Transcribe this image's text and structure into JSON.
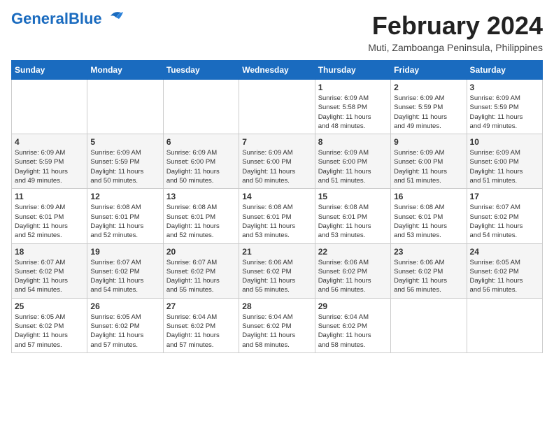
{
  "header": {
    "logo_general": "General",
    "logo_blue": "Blue",
    "title": "February 2024",
    "location": "Muti, Zamboanga Peninsula, Philippines"
  },
  "days_of_week": [
    "Sunday",
    "Monday",
    "Tuesday",
    "Wednesday",
    "Thursday",
    "Friday",
    "Saturday"
  ],
  "weeks": [
    [
      {
        "day": "",
        "info": ""
      },
      {
        "day": "",
        "info": ""
      },
      {
        "day": "",
        "info": ""
      },
      {
        "day": "",
        "info": ""
      },
      {
        "day": "1",
        "info": "Sunrise: 6:09 AM\nSunset: 5:58 PM\nDaylight: 11 hours\nand 48 minutes."
      },
      {
        "day": "2",
        "info": "Sunrise: 6:09 AM\nSunset: 5:59 PM\nDaylight: 11 hours\nand 49 minutes."
      },
      {
        "day": "3",
        "info": "Sunrise: 6:09 AM\nSunset: 5:59 PM\nDaylight: 11 hours\nand 49 minutes."
      }
    ],
    [
      {
        "day": "4",
        "info": "Sunrise: 6:09 AM\nSunset: 5:59 PM\nDaylight: 11 hours\nand 49 minutes."
      },
      {
        "day": "5",
        "info": "Sunrise: 6:09 AM\nSunset: 5:59 PM\nDaylight: 11 hours\nand 50 minutes."
      },
      {
        "day": "6",
        "info": "Sunrise: 6:09 AM\nSunset: 6:00 PM\nDaylight: 11 hours\nand 50 minutes."
      },
      {
        "day": "7",
        "info": "Sunrise: 6:09 AM\nSunset: 6:00 PM\nDaylight: 11 hours\nand 50 minutes."
      },
      {
        "day": "8",
        "info": "Sunrise: 6:09 AM\nSunset: 6:00 PM\nDaylight: 11 hours\nand 51 minutes."
      },
      {
        "day": "9",
        "info": "Sunrise: 6:09 AM\nSunset: 6:00 PM\nDaylight: 11 hours\nand 51 minutes."
      },
      {
        "day": "10",
        "info": "Sunrise: 6:09 AM\nSunset: 6:00 PM\nDaylight: 11 hours\nand 51 minutes."
      }
    ],
    [
      {
        "day": "11",
        "info": "Sunrise: 6:09 AM\nSunset: 6:01 PM\nDaylight: 11 hours\nand 52 minutes."
      },
      {
        "day": "12",
        "info": "Sunrise: 6:08 AM\nSunset: 6:01 PM\nDaylight: 11 hours\nand 52 minutes."
      },
      {
        "day": "13",
        "info": "Sunrise: 6:08 AM\nSunset: 6:01 PM\nDaylight: 11 hours\nand 52 minutes."
      },
      {
        "day": "14",
        "info": "Sunrise: 6:08 AM\nSunset: 6:01 PM\nDaylight: 11 hours\nand 53 minutes."
      },
      {
        "day": "15",
        "info": "Sunrise: 6:08 AM\nSunset: 6:01 PM\nDaylight: 11 hours\nand 53 minutes."
      },
      {
        "day": "16",
        "info": "Sunrise: 6:08 AM\nSunset: 6:01 PM\nDaylight: 11 hours\nand 53 minutes."
      },
      {
        "day": "17",
        "info": "Sunrise: 6:07 AM\nSunset: 6:02 PM\nDaylight: 11 hours\nand 54 minutes."
      }
    ],
    [
      {
        "day": "18",
        "info": "Sunrise: 6:07 AM\nSunset: 6:02 PM\nDaylight: 11 hours\nand 54 minutes."
      },
      {
        "day": "19",
        "info": "Sunrise: 6:07 AM\nSunset: 6:02 PM\nDaylight: 11 hours\nand 54 minutes."
      },
      {
        "day": "20",
        "info": "Sunrise: 6:07 AM\nSunset: 6:02 PM\nDaylight: 11 hours\nand 55 minutes."
      },
      {
        "day": "21",
        "info": "Sunrise: 6:06 AM\nSunset: 6:02 PM\nDaylight: 11 hours\nand 55 minutes."
      },
      {
        "day": "22",
        "info": "Sunrise: 6:06 AM\nSunset: 6:02 PM\nDaylight: 11 hours\nand 56 minutes."
      },
      {
        "day": "23",
        "info": "Sunrise: 6:06 AM\nSunset: 6:02 PM\nDaylight: 11 hours\nand 56 minutes."
      },
      {
        "day": "24",
        "info": "Sunrise: 6:05 AM\nSunset: 6:02 PM\nDaylight: 11 hours\nand 56 minutes."
      }
    ],
    [
      {
        "day": "25",
        "info": "Sunrise: 6:05 AM\nSunset: 6:02 PM\nDaylight: 11 hours\nand 57 minutes."
      },
      {
        "day": "26",
        "info": "Sunrise: 6:05 AM\nSunset: 6:02 PM\nDaylight: 11 hours\nand 57 minutes."
      },
      {
        "day": "27",
        "info": "Sunrise: 6:04 AM\nSunset: 6:02 PM\nDaylight: 11 hours\nand 57 minutes."
      },
      {
        "day": "28",
        "info": "Sunrise: 6:04 AM\nSunset: 6:02 PM\nDaylight: 11 hours\nand 58 minutes."
      },
      {
        "day": "29",
        "info": "Sunrise: 6:04 AM\nSunset: 6:02 PM\nDaylight: 11 hours\nand 58 minutes."
      },
      {
        "day": "",
        "info": ""
      },
      {
        "day": "",
        "info": ""
      }
    ]
  ]
}
